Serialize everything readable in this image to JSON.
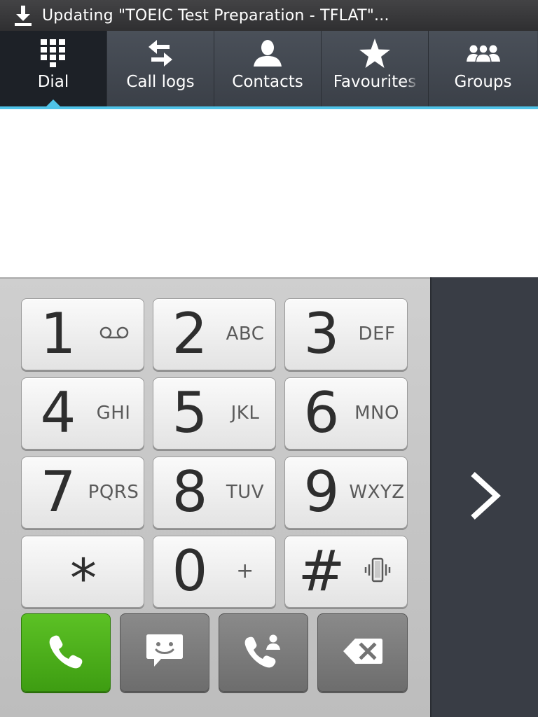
{
  "status_bar": {
    "icon": "download-icon",
    "title": "Updating \"TOEIC Test Preparation - TFLAT\"..."
  },
  "tabs": [
    {
      "label": "Dial",
      "icon": "dialpad-icon",
      "active": true
    },
    {
      "label": "Call logs",
      "icon": "swap-arrows-icon",
      "active": false
    },
    {
      "label": "Contacts",
      "icon": "person-icon",
      "active": false
    },
    {
      "label": "Favourites",
      "icon": "star-icon",
      "active": false
    },
    {
      "label": "Groups",
      "icon": "group-icon",
      "active": false
    }
  ],
  "display": {
    "number": ""
  },
  "keys": [
    {
      "num": "1",
      "letters": "",
      "sub_icon": "voicemail-icon"
    },
    {
      "num": "2",
      "letters": "ABC"
    },
    {
      "num": "3",
      "letters": "DEF"
    },
    {
      "num": "4",
      "letters": "GHI"
    },
    {
      "num": "5",
      "letters": "JKL"
    },
    {
      "num": "6",
      "letters": "MNO"
    },
    {
      "num": "7",
      "letters": "PQRS"
    },
    {
      "num": "8",
      "letters": "TUV"
    },
    {
      "num": "9",
      "letters": "WXYZ"
    },
    {
      "num": "*",
      "letters": ""
    },
    {
      "num": "0",
      "letters": "+"
    },
    {
      "num": "#",
      "letters": "",
      "sub_icon": "vibrate-icon"
    }
  ],
  "actions": [
    {
      "name": "call-button",
      "icon": "phone-icon"
    },
    {
      "name": "message-button",
      "icon": "message-icon"
    },
    {
      "name": "add-contact-button",
      "icon": "phone-add-contact-icon"
    },
    {
      "name": "backspace-button",
      "icon": "backspace-icon"
    }
  ],
  "side_panel": {
    "icon": "chevron-right-icon"
  },
  "colors": {
    "accent": "#4fc3e8",
    "call_green": "#4caf1a",
    "tab_bg": "#3f444d",
    "panel_bg": "#393d45"
  }
}
